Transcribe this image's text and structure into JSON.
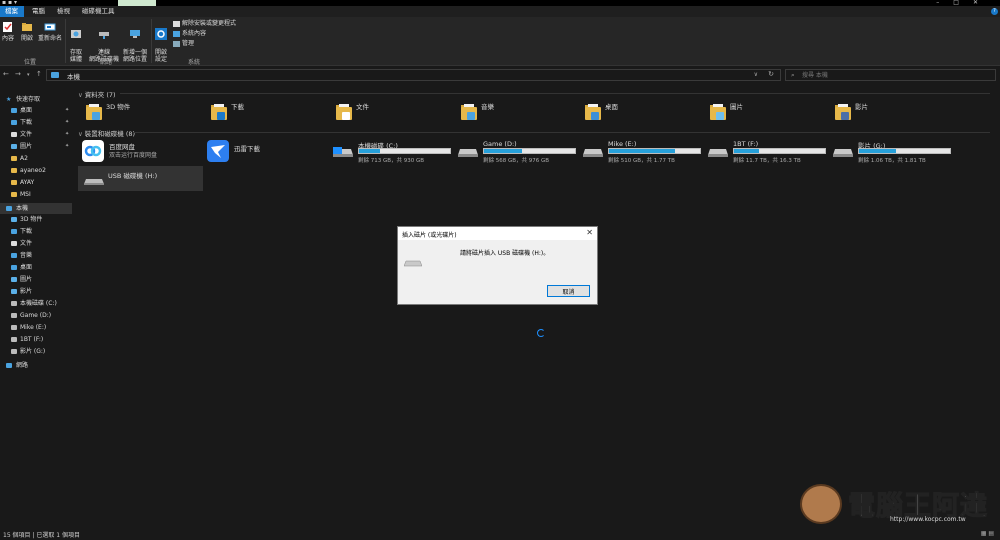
{
  "tabs": {
    "file": "檔案",
    "computer": "電腦",
    "view": "檢視",
    "drive_tools": "磁碟機工具"
  },
  "ribbon": {
    "properties": "內容",
    "open": "開啟",
    "rename": "重新命名",
    "location_group": "位置",
    "access_media": "存取\n媒體",
    "map_drive": "連線\n網路磁碟機",
    "add_location": "新增一個\n網路位置",
    "network_group": "網路",
    "open_settings": "開啟\n設定",
    "uninstall": "解除安裝或變更程式",
    "system_props": "系統內容",
    "manage": "管理",
    "system_group": "系統"
  },
  "address": {
    "path": "本機",
    "search_placeholder": "搜尋 本機"
  },
  "sidebar": {
    "quick_access": "快速存取",
    "items": [
      "桌面",
      "下載",
      "文件",
      "圖片",
      "A2",
      "ayaneo2",
      "AYAY",
      "MSI"
    ],
    "this_pc": "本機",
    "pc_items": [
      "3D 物件",
      "下載",
      "文件",
      "音樂",
      "桌面",
      "圖片",
      "影片",
      "本機磁碟 (C:)",
      "Game (D:)",
      "Mike (E:)",
      "1BT (F:)",
      "影片 (G:)"
    ],
    "network": "網路"
  },
  "main": {
    "folders_title": "資料夾 (7)",
    "folders": [
      "3D 物件",
      "下載",
      "文件",
      "音樂",
      "桌面",
      "圖片",
      "影片"
    ],
    "devices_title": "裝置和磁碟機 (8)",
    "apps": [
      {
        "name": "百度网盘",
        "sub": "双击运行百度网盘"
      },
      {
        "name": "迅雷下載",
        "sub": ""
      }
    ],
    "drives": [
      {
        "name": "本機磁碟 (C:)",
        "free": "剩餘 713 GB，共 930 GB",
        "used_fraction": 0.23
      },
      {
        "name": "Game (D:)",
        "free": "剩餘 568 GB，共 976 GB",
        "used_fraction": 0.42
      },
      {
        "name": "Mike (E:)",
        "free": "剩餘 510 GB，共 1.77 TB",
        "used_fraction": 0.72
      },
      {
        "name": "1BT (F:)",
        "free": "剩餘 11.7 TB，共 16.3 TB",
        "used_fraction": 0.28
      },
      {
        "name": "影片 (G:)",
        "free": "剩餘 1.06 TB，共 1.81 TB",
        "used_fraction": 0.41
      }
    ],
    "usb": "USB 磁碟機 (H:)"
  },
  "dialog": {
    "title": "插入磁片 (或光碟片)",
    "message": "請將磁片插入 USB 磁碟機 (H:)。",
    "cancel": "取消"
  },
  "status": {
    "text": "15 個項目 | 已選取 1 個項目"
  },
  "watermark": {
    "brand": "電腦王阿達",
    "url": "http://www.kocpc.com.tw"
  },
  "colors": {
    "accent": "#1979ca",
    "drive_bar": "#26a0da",
    "folder": "#e6b84a"
  }
}
